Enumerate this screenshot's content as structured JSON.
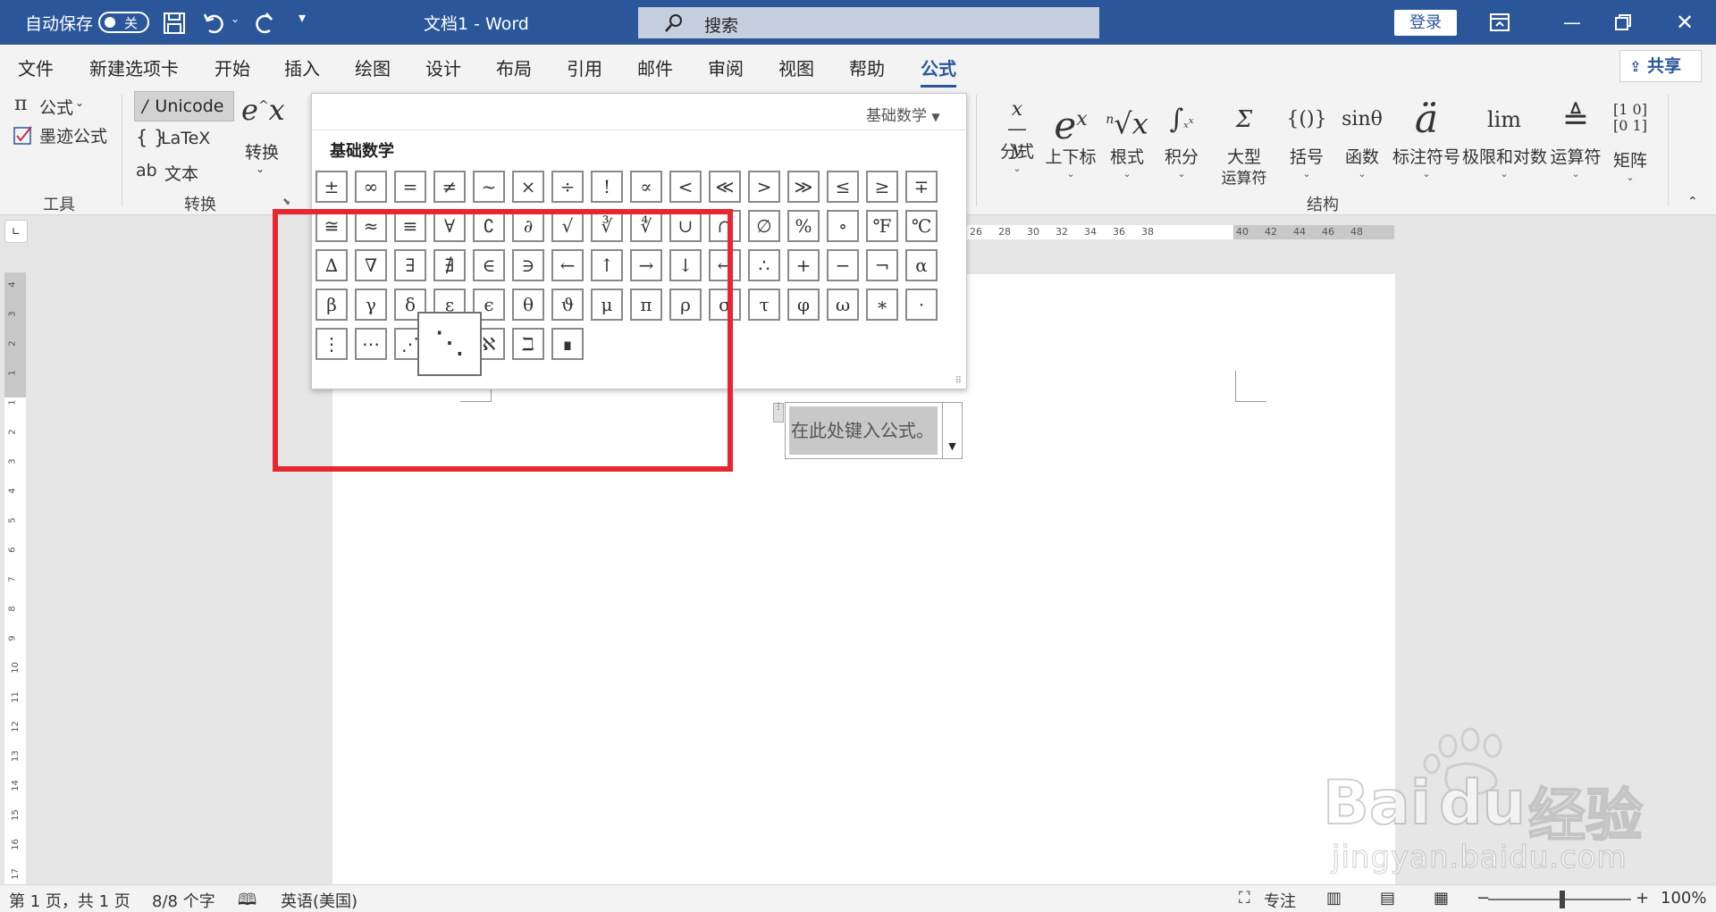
{
  "titlebar": {
    "autosave": "自动保存",
    "autosave_state": "关",
    "doc_title": "文档1  -  Word",
    "search_placeholder": "搜索",
    "login": "登录"
  },
  "menu": {
    "items": [
      "文件",
      "新建选项卡",
      "开始",
      "插入",
      "绘图",
      "设计",
      "布局",
      "引用",
      "邮件",
      "审阅",
      "视图",
      "帮助",
      "公式"
    ],
    "active": "公式",
    "share": "共享"
  },
  "ribbon": {
    "tools": {
      "equation": "公式",
      "ink_equation": "墨迹公式",
      "group_label": "工具"
    },
    "convert": {
      "unicode": "Unicode",
      "latex": "LaTeX",
      "text": "文本",
      "convert_label": "转换",
      "group_label": "转换"
    },
    "structures": {
      "group_label": "结构",
      "items": [
        {
          "label": "分式"
        },
        {
          "label": "上下标"
        },
        {
          "label": "根式"
        },
        {
          "label": "积分"
        },
        {
          "label": "大型",
          "label2": "运算符"
        },
        {
          "label": "括号"
        },
        {
          "label": "函数"
        },
        {
          "label": "标注符号"
        },
        {
          "label": "极限和对数"
        },
        {
          "label": "运算符"
        },
        {
          "label": "矩阵"
        }
      ]
    }
  },
  "gallery": {
    "category": "基础数学",
    "heading": "基础数学",
    "rows": [
      [
        "±",
        "∞",
        "=",
        "≠",
        "~",
        "×",
        "÷",
        "!",
        "∝",
        "<",
        "≪",
        ">",
        "≫",
        "≤",
        "≥",
        "∓"
      ],
      [
        "≅",
        "≈",
        "≡",
        "∀",
        "∁",
        "∂",
        "√",
        "∛",
        "∜",
        "∪",
        "∩",
        "∅",
        "%",
        "∘",
        "℉",
        "℃"
      ],
      [
        "∆",
        "∇",
        "∃",
        "∄",
        "∈",
        "∋",
        "←",
        "↑",
        "→",
        "↓",
        "↔",
        "∴",
        "+",
        "−",
        "¬",
        "α"
      ],
      [
        "β",
        "γ",
        "δ",
        "ε",
        "ϵ",
        "θ",
        "ϑ",
        "μ",
        "π",
        "ρ",
        "σ",
        "τ",
        "φ",
        "ω",
        "∗",
        "·"
      ],
      [
        "⋮",
        "⋯",
        "⋰",
        "⋱",
        "ℵ",
        "ℶ",
        "∎"
      ]
    ]
  },
  "ruler": {
    "h_labels": [
      "26",
      "28",
      "30",
      "32",
      "34",
      "36",
      "38",
      "40",
      "42",
      "44",
      "46",
      "48"
    ],
    "v_labels": [
      "4",
      "3",
      "2",
      "1",
      "1",
      "2",
      "3",
      "4",
      "5",
      "6",
      "7",
      "8",
      "9",
      "10",
      "11",
      "12",
      "13",
      "14",
      "15",
      "16",
      "17"
    ]
  },
  "document": {
    "equation_placeholder": "在此处键入公式。"
  },
  "status": {
    "page": "第 1 页，共 1 页",
    "words": "8/8 个字",
    "language": "英语(美国)",
    "focus": "专注",
    "zoom_minus": "−",
    "zoom_plus": "+",
    "zoom": "100%",
    "zoom_level_percent": 100
  },
  "watermark": {
    "text1": "Bai",
    "text2": "du",
    "text3": "经验",
    "url": "jingyan.baidu.com"
  },
  "colors": {
    "word_blue": "#2b579a",
    "highlight_red": "#e8262f"
  }
}
